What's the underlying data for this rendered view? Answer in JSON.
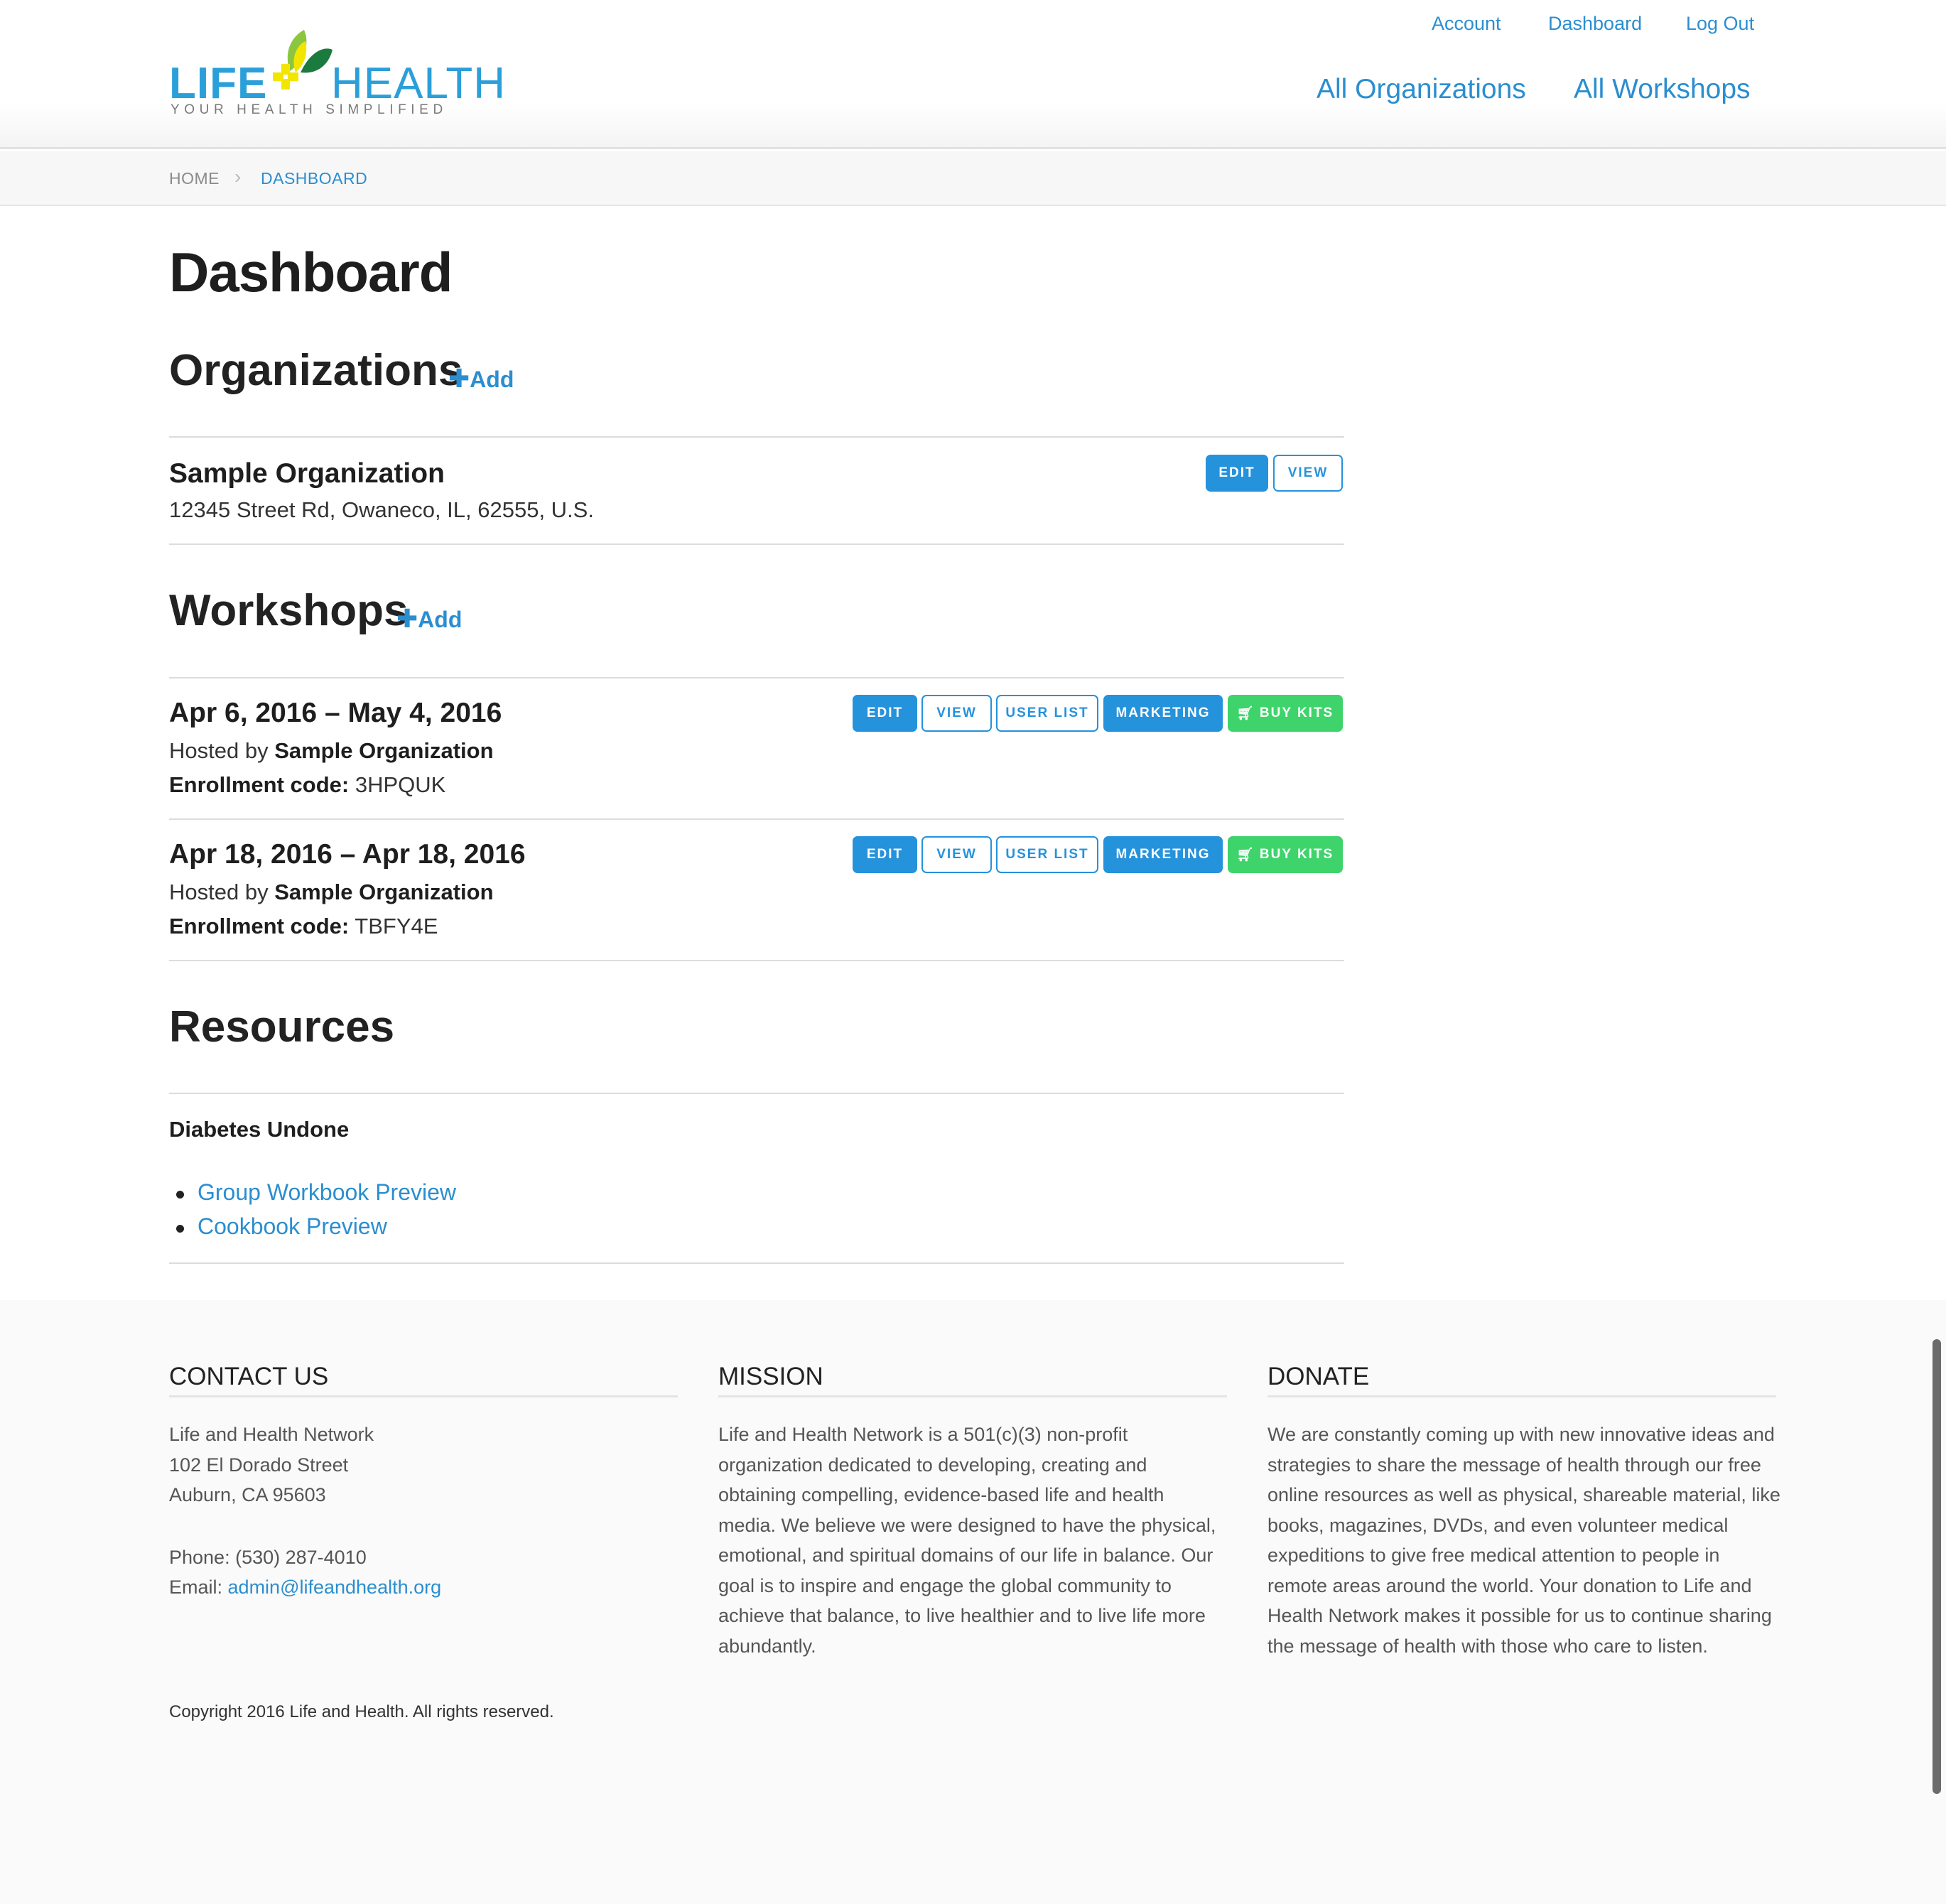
{
  "header": {
    "logo": {
      "life": "LIFE",
      "health": "HEALTH",
      "tagline": "YOUR HEALTH SIMPLIFIED"
    },
    "util_nav": [
      "Account",
      "Dashboard",
      "Log Out"
    ],
    "main_nav": [
      "All Organizations",
      "All Workshops"
    ]
  },
  "breadcrumb": {
    "home": "HOME",
    "current": "DASHBOARD"
  },
  "page_title": "Dashboard",
  "organizations": {
    "title": "Organizations",
    "add_label": "Add",
    "items": [
      {
        "name": "Sample Organization",
        "address": "12345 Street Rd, Owaneco, IL, 62555, U.S.",
        "buttons": [
          "EDIT",
          "VIEW"
        ]
      }
    ]
  },
  "workshops": {
    "title": "Workshops",
    "add_label": "Add",
    "hosted_by_label": "Hosted by",
    "enrollment_label": "Enrollment code:",
    "buttons": {
      "edit": "EDIT",
      "view": "VIEW",
      "user_list": "USER LIST",
      "marketing": "MARKETING",
      "buy_kits": "BUY KITS"
    },
    "items": [
      {
        "dates": "Apr 6, 2016 – May 4, 2016",
        "host": "Sample Organization",
        "code": "3HPQUK"
      },
      {
        "dates": "Apr 18, 2016 – Apr 18, 2016",
        "host": "Sample Organization",
        "code": "TBFY4E"
      }
    ]
  },
  "resources": {
    "title": "Resources",
    "group": "Diabetes Undone",
    "links": [
      "Group Workbook Preview",
      "Cookbook Preview"
    ]
  },
  "footer": {
    "contact": {
      "title": "CONTACT US",
      "org": "Life and Health Network",
      "street": "102 El Dorado Street",
      "city": "Auburn, CA 95603",
      "phone": "Phone: (530) 287-4010",
      "email_label": "Email:",
      "email": "admin@lifeandhealth.org"
    },
    "mission": {
      "title": "MISSION",
      "text": "Life and Health Network is a 501(c)(3) non-profit organization dedicated to developing, creating and obtaining compelling, evidence-based life and health media. We believe we were designed to have the physical, emotional, and spiritual domains of our life in balance. Our goal is to inspire and engage the global community to achieve that balance, to live healthier and to live life more abundantly."
    },
    "donate": {
      "title": "DONATE",
      "text": "We are constantly coming up with new innovative ideas and strategies to share the message of health through our free online resources as well as physical, shareable material, like books, magazines, DVDs, and even volunteer medical expeditions to give free medical attention to people in remote areas around the world. Your donation to Life and Health Network makes it possible for us to continue sharing the message of health with those who care to listen."
    },
    "copyright": "Copyright 2016 Life and Health. All rights reserved."
  },
  "colors": {
    "link": "#2b8ed0",
    "button_blue": "#2592dc",
    "button_green": "#3ed46b"
  },
  "icons": {
    "add": "plus-icon",
    "buy_kits": "cart-icon",
    "breadcrumb_separator": "chevron-right-icon"
  }
}
